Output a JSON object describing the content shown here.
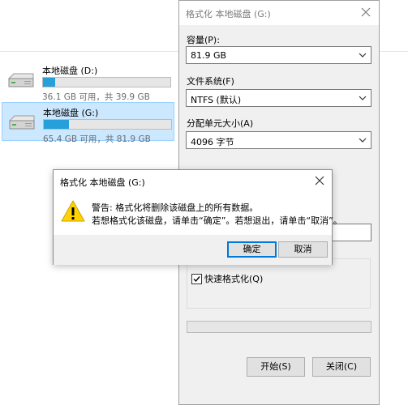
{
  "explorer": {
    "drives": [
      {
        "name": "本地磁盘 (D:)",
        "info": "36.1 GB 可用，共 39.9 GB",
        "used_fraction": 0.095,
        "selected": false
      },
      {
        "name": "本地磁盘 (G:)",
        "info": "65.4 GB 可用，共 81.9 GB",
        "used_fraction": 0.2,
        "selected": true
      }
    ]
  },
  "format_window": {
    "title": "格式化 本地磁盘 (G:)",
    "capacity_label": "容量(P):",
    "capacity_value": "81.9 GB",
    "filesystem_label": "文件系统(F)",
    "filesystem_value": "NTFS (默认)",
    "allocation_label": "分配单元大小(A)",
    "allocation_value": "4096 字节",
    "quick_format_label": "快速格式化(Q)",
    "quick_format_checked": true,
    "progress": 0,
    "start_button": "开始(S)",
    "close_button": "关闭(C)"
  },
  "warning_dialog": {
    "title": "格式化 本地磁盘 (G:)",
    "line1": "警告: 格式化将删除该磁盘上的所有数据。",
    "line2": "若想格式化该磁盘，请单击“确定”。若想退出，请单击“取消”。",
    "ok_button": "确定",
    "cancel_button": "取消"
  },
  "colors": {
    "accent": "#0078d7",
    "drive_bar_fill": "#26a0da",
    "selection_bg": "#cce8ff",
    "warning_yellow": "#ffd200"
  }
}
